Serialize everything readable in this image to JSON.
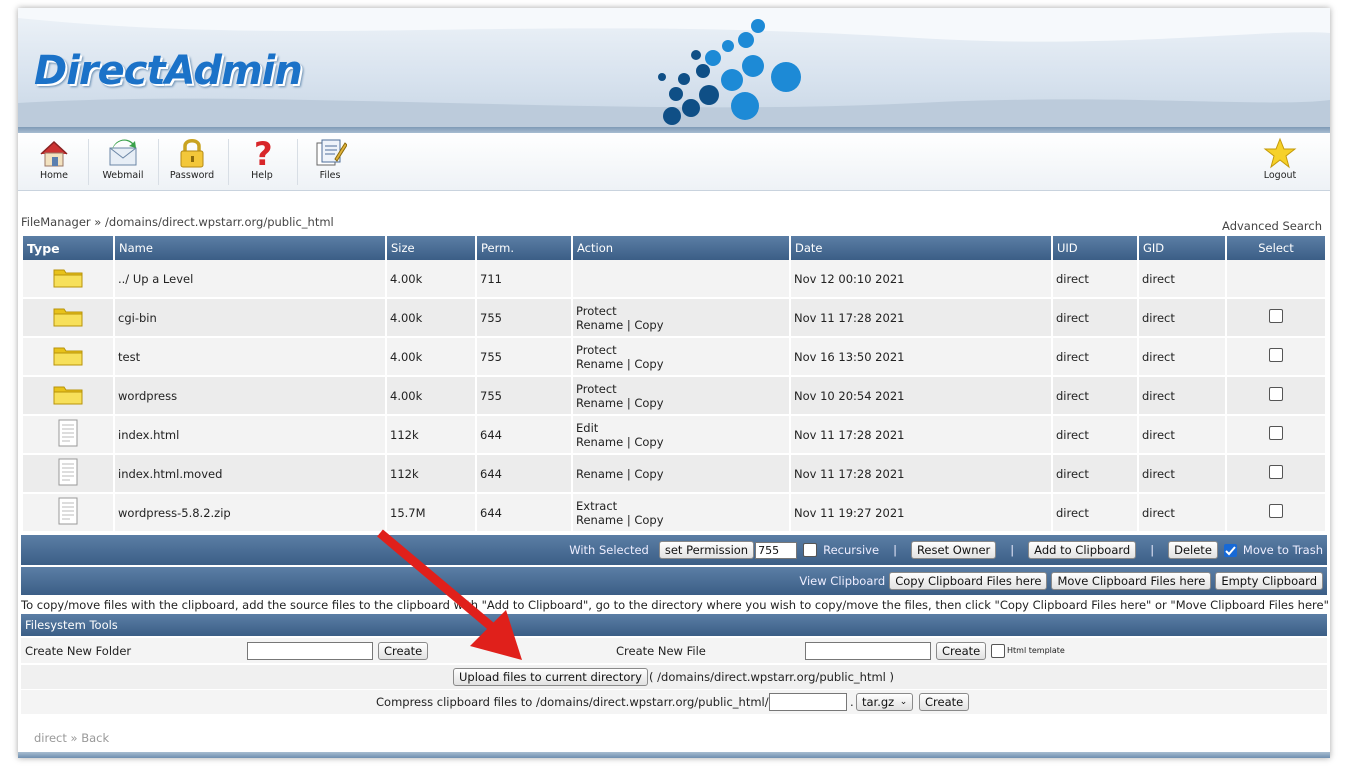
{
  "header": {
    "logo_text": "DirectAdmin"
  },
  "nav": [
    {
      "label": "Home",
      "icon": "home-icon"
    },
    {
      "label": "Webmail",
      "icon": "webmail-icon"
    },
    {
      "label": "Password",
      "icon": "lock-icon"
    },
    {
      "label": "Help",
      "icon": "help-icon"
    },
    {
      "label": "Files",
      "icon": "files-icon"
    }
  ],
  "logout": {
    "label": "Logout",
    "icon": "star-icon"
  },
  "breadcrumb": {
    "root": "FileManager",
    "sep": " » ",
    "path": "/domains/direct.wpstarr.org/public_html"
  },
  "advanced_search": "Advanced Search",
  "table": {
    "headers": {
      "type": "Type",
      "name": "Name",
      "size": "Size",
      "perm": "Perm.",
      "action": "Action",
      "date": "Date",
      "uid": "UID",
      "gid": "GID",
      "select": "Select"
    },
    "rows": [
      {
        "kind": "folder",
        "name": "../ Up a Level",
        "size": "4.00k",
        "perm": "711",
        "act1": "",
        "act2a": "",
        "act2b": "",
        "date": "Nov 12 00:10 2021",
        "uid": "direct",
        "gid": "direct",
        "checkbox": false
      },
      {
        "kind": "folder",
        "name": "cgi-bin",
        "size": "4.00k",
        "perm": "755",
        "act1": "Protect",
        "act2a": "Rename",
        "act2b": "Copy",
        "date": "Nov 11 17:28 2021",
        "uid": "direct",
        "gid": "direct",
        "checkbox": true
      },
      {
        "kind": "folder",
        "name": "test",
        "size": "4.00k",
        "perm": "755",
        "act1": "Protect",
        "act2a": "Rename",
        "act2b": "Copy",
        "date": "Nov 16 13:50 2021",
        "uid": "direct",
        "gid": "direct",
        "checkbox": true
      },
      {
        "kind": "folder",
        "name": "wordpress",
        "size": "4.00k",
        "perm": "755",
        "act1": "Protect",
        "act2a": "Rename",
        "act2b": "Copy",
        "date": "Nov 10 20:54 2021",
        "uid": "direct",
        "gid": "direct",
        "checkbox": true
      },
      {
        "kind": "file",
        "name": "index.html",
        "size": "112k",
        "perm": "644",
        "act1": "Edit",
        "act2a": "Rename",
        "act2b": "Copy",
        "date": "Nov 11 17:28 2021",
        "uid": "direct",
        "gid": "direct",
        "checkbox": true
      },
      {
        "kind": "file",
        "name": "index.html.moved",
        "size": "112k",
        "perm": "644",
        "act1": "",
        "act2a": "Rename",
        "act2b": "Copy",
        "date": "Nov 11 17:28 2021",
        "uid": "direct",
        "gid": "direct",
        "checkbox": true
      },
      {
        "kind": "file",
        "name": "wordpress-5.8.2.zip",
        "size": "15.7M",
        "perm": "644",
        "act1": "Extract",
        "act2a": "Rename",
        "act2b": "Copy",
        "date": "Nov 11 19:27 2021",
        "uid": "direct",
        "gid": "direct",
        "checkbox": true
      }
    ],
    "action_sep": "|"
  },
  "with_selected": {
    "label": "With Selected",
    "set_permission": "set Permission",
    "permission_value": "755",
    "recursive": "Recursive",
    "sep": "|",
    "reset_owner": "Reset Owner",
    "add_clipboard": "Add to Clipboard",
    "delete": "Delete",
    "move_to_trash": "Move to Trash"
  },
  "clipboard": {
    "view": "View Clipboard",
    "copy": "Copy Clipboard Files here",
    "move": "Move Clipboard Files here",
    "empty": "Empty Clipboard"
  },
  "note": "To copy/move files with the clipboard, add the source files to the clipboard with \"Add to Clipboard\", go to the directory where you wish to copy/move the files, then click \"Copy Clipboard Files here\" or \"Move Clipboard Files here\"",
  "tools": {
    "title": "Filesystem Tools",
    "new_folder": "Create New Folder",
    "new_file": "Create New File",
    "create": "Create",
    "html_template": "Html template",
    "upload": "Upload files to current directory",
    "upload_path": "( /domains/direct.wpstarr.org/public_html )",
    "compress_label": "Compress clipboard files to /domains/direct.wpstarr.org/public_html/",
    "compress_dot": ".",
    "compress_format": "tar.gz"
  },
  "footer": {
    "user": "direct",
    "sep": " » ",
    "back": "Back"
  },
  "colors": {
    "header_blue": "#3b5e86",
    "logo": "#1b72c8",
    "annotation_arrow": "#e0201b"
  }
}
